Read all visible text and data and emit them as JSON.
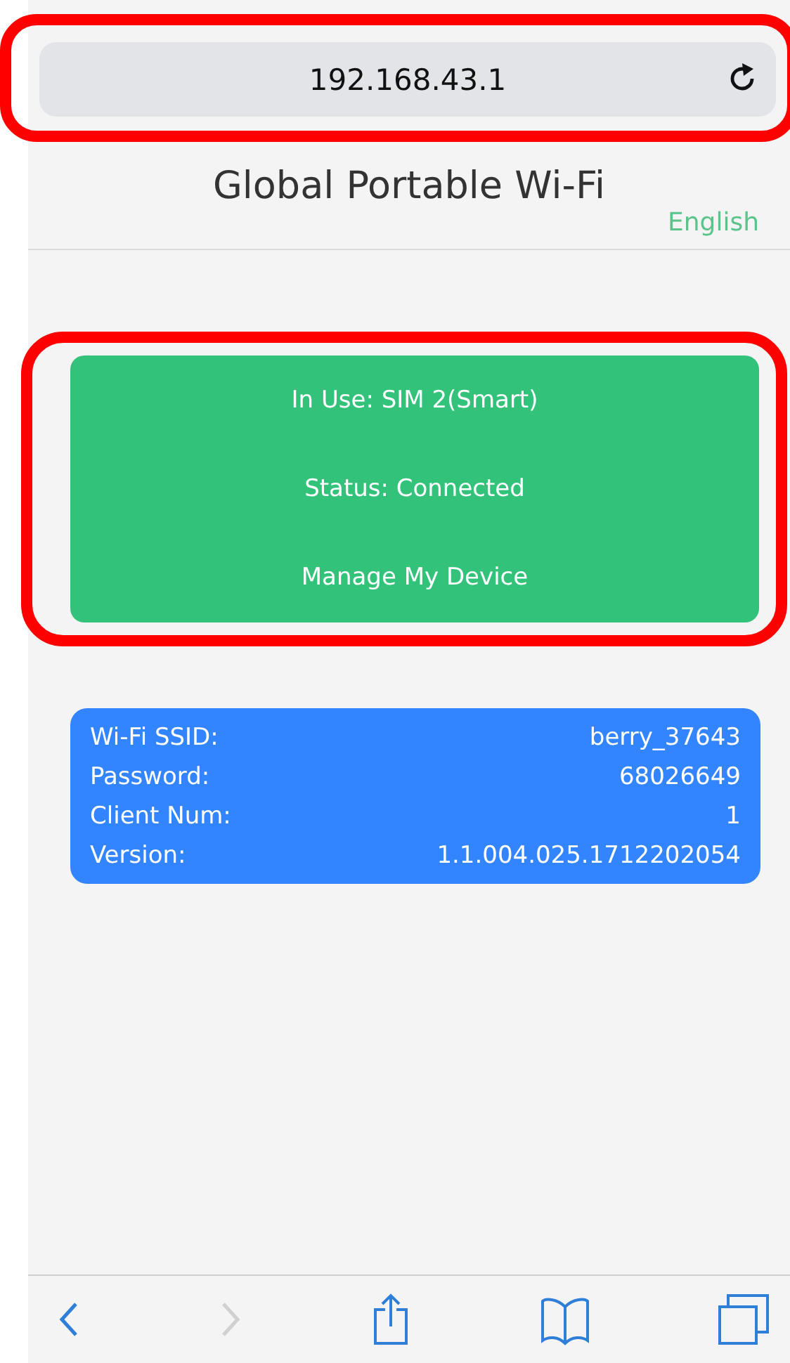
{
  "address_bar": {
    "url": "192.168.43.1",
    "highlighted": true
  },
  "header": {
    "title": "Global Portable Wi-Fi",
    "language": "English"
  },
  "status_card": {
    "highlighted": true,
    "lines": [
      {
        "text": "In Use: SIM 2(Smart)"
      },
      {
        "text": "Status: Connected"
      },
      {
        "text": "Manage My Device"
      }
    ]
  },
  "info_card": {
    "rows": [
      {
        "label": "Wi-Fi SSID:",
        "value": "berry_37643"
      },
      {
        "label": "Password:",
        "value": "68026649"
      },
      {
        "label": "Client Num:",
        "value": "1"
      },
      {
        "label": "Version:",
        "value": "1.1.004.025.1712202054"
      }
    ]
  },
  "toolbar": {
    "items": [
      {
        "kind": "back",
        "disabled": false
      },
      {
        "kind": "forward",
        "disabled": true
      },
      {
        "kind": "share",
        "disabled": false
      },
      {
        "kind": "bookmarks",
        "disabled": false
      },
      {
        "kind": "tabs",
        "disabled": false
      }
    ]
  }
}
